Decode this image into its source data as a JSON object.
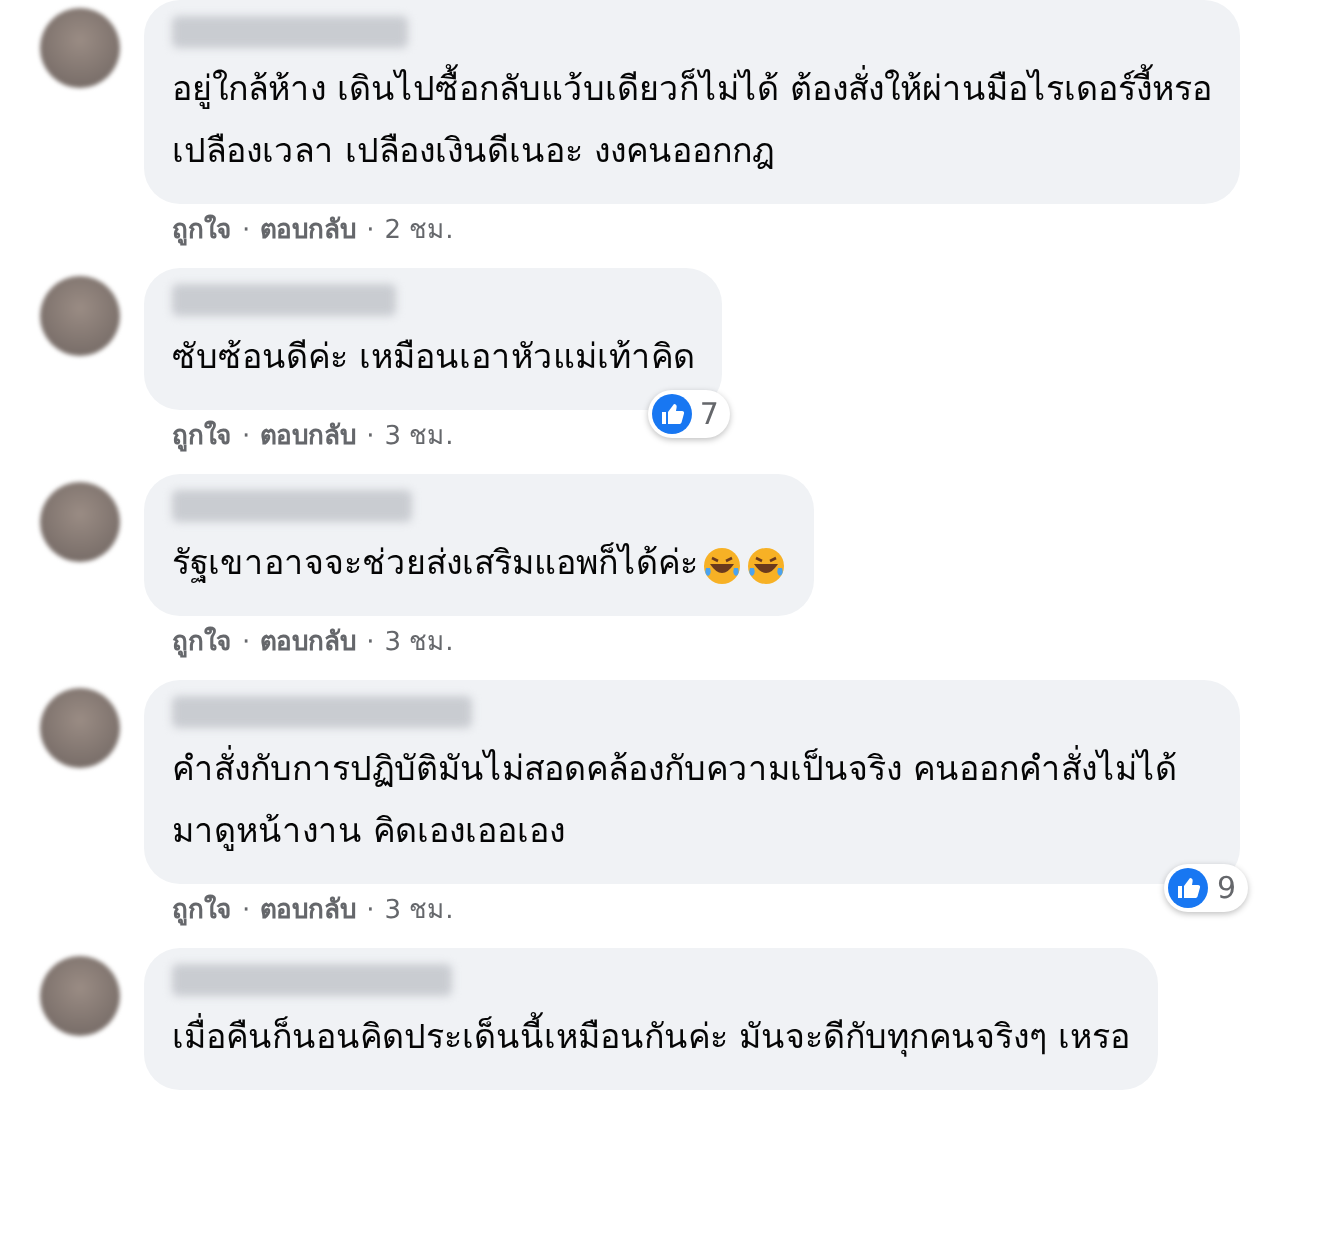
{
  "comments": [
    {
      "text": "อยู่ใกล้ห้าง เดินไปซื้อกลับแว้บเดียวก็ไม่ได้ ต้องสั่งให้ผ่านมือไรเดอร์งี้หรอ เปลืองเวลา เปลืองเงินดีเนอะ งงคนออกกฎ",
      "meta": [
        {
          "kind": "action",
          "text": "ถูกใจ"
        },
        {
          "kind": "separator",
          "text": "·"
        },
        {
          "kind": "action",
          "text": "ตอบกลับ"
        },
        {
          "kind": "separator",
          "text": "·"
        },
        {
          "kind": "time",
          "text": "2 ชม."
        }
      ]
    },
    {
      "text": "ซับซ้อนดีค่ะ เหมือนเอาหัวแม่เท้าคิด",
      "reactions": "7",
      "meta": [
        {
          "kind": "action",
          "text": "ถูกใจ"
        },
        {
          "kind": "separator",
          "text": "·"
        },
        {
          "kind": "action",
          "text": "ตอบกลับ"
        },
        {
          "kind": "separator",
          "text": "·"
        },
        {
          "kind": "time",
          "text": "3 ชม."
        }
      ]
    },
    {
      "text": "รัฐเขาอาจจะช่วยส่งเสริมแอพก็ได้ค่ะ",
      "emojis": [
        {
          "kind": "laughing"
        },
        {
          "kind": "laughing"
        }
      ],
      "meta": [
        {
          "kind": "action",
          "text": "ถูกใจ"
        },
        {
          "kind": "separator",
          "text": "·"
        },
        {
          "kind": "action",
          "text": "ตอบกลับ"
        },
        {
          "kind": "separator",
          "text": "·"
        },
        {
          "kind": "time",
          "text": "3 ชม."
        }
      ]
    },
    {
      "text": "คำสั่งกับการปฏิบัติมันไม่สอดคล้องกับความเป็นจริง คนออกคำสั่งไม่ได้มาดูหน้างาน คิดเองเออเอง",
      "reactions": "9",
      "meta": [
        {
          "kind": "action",
          "text": "ถูกใจ"
        },
        {
          "kind": "separator",
          "text": "·"
        },
        {
          "kind": "action",
          "text": "ตอบกลับ"
        },
        {
          "kind": "separator",
          "text": "·"
        },
        {
          "kind": "time",
          "text": "3 ชม."
        }
      ]
    },
    {
      "text": "เมื่อคืนก็นอนคิดประเด็นนี้เหมือนกันค่ะ มันจะดีกับทุกคนจริงๆ เหรอ"
    }
  ]
}
